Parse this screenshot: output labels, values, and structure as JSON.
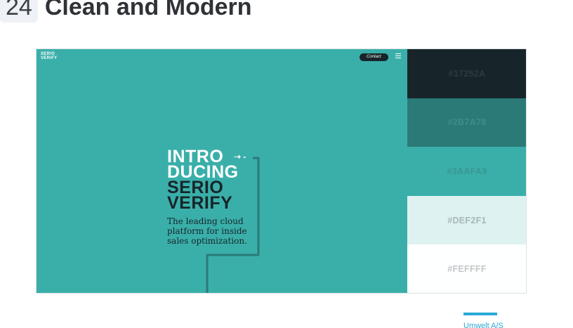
{
  "header": {
    "number": "24",
    "title": "Clean and Modern"
  },
  "hero": {
    "logo_line1": "SERIO",
    "logo_line2": "VERIFY",
    "contact_label": "Contact",
    "headline_line1": "INTRO",
    "headline_line2": "DUCING",
    "headline_line3": "SERIO",
    "headline_line4": "VERIFY",
    "arrow": "➝ -",
    "tagline": "The leading cloud platform for inside sales optimization."
  },
  "palette": [
    {
      "hex": "#17252A",
      "label": "#17252A",
      "text_color": "#2c3b40"
    },
    {
      "hex": "#2B7A78",
      "label": "#2B7A78",
      "text_color": "#3d8d8a"
    },
    {
      "hex": "#3AAFA9",
      "label": "#3AAFA9",
      "text_color": "#3a9692"
    },
    {
      "hex": "#DEF2F1",
      "label": "#DEF2F1",
      "text_color": "#a6b8b8"
    },
    {
      "hex": "#FEFFFF",
      "label": "#FEFFFF",
      "text_color": "#c2c6c7"
    }
  ],
  "footer": {
    "link_text": "Umwelt A/S"
  }
}
